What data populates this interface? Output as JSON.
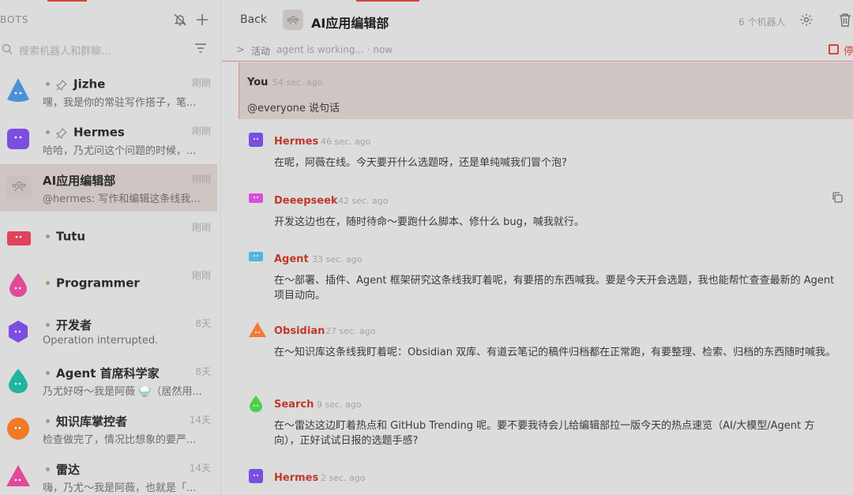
{
  "sidebar": {
    "title": "BOTS",
    "search_placeholder": "搜索机器人和群聊...",
    "items": [
      {
        "name": "Jizhe",
        "time": "刚刚",
        "preview": "嘿，我是你的常驻写作搭子，笔...",
        "pinned": true,
        "color": "#4a90d9",
        "shape": "drop"
      },
      {
        "name": "Hermes",
        "time": "刚刚",
        "preview": "哈哈，乃尤问这个问题的时候，...",
        "pinned": true,
        "color": "#7b4ee0",
        "shape": "square"
      },
      {
        "name": "AI应用编辑部",
        "time": "刚刚",
        "preview": "@hermes: 写作和编辑这条线我...",
        "pinned": false,
        "color": "#c8c2bf",
        "shape": "group"
      },
      {
        "name": "Tutu",
        "time": "刚刚",
        "preview": "",
        "pinned": false,
        "color": "#e0445a",
        "shape": "rect"
      },
      {
        "name": "Programmer",
        "time": "刚刚",
        "preview": "",
        "pinned": false,
        "color": "#e04a98",
        "shape": "drop"
      },
      {
        "name": "开发者",
        "time": "8天",
        "preview": "Operation interrupted.",
        "pinned": false,
        "color": "#7b4ee0",
        "shape": "hex"
      },
      {
        "name": "Agent 首席科学家",
        "time": "8天",
        "preview": "乃尤好呀～我是阿薇 🍚（居然用...",
        "pinned": false,
        "color": "#1fb5a0",
        "shape": "drop"
      },
      {
        "name": "知识库掌控者",
        "time": "14天",
        "preview": "检查做完了，情况比想象的要严...",
        "pinned": false,
        "color": "#f07a28",
        "shape": "circle"
      },
      {
        "name": "雷达",
        "time": "14天",
        "preview": "嗨，乃尤～我是阿薇，也就是「...",
        "pinned": false,
        "color": "#e04a98",
        "shape": "triangle"
      }
    ]
  },
  "header": {
    "back_label": "Back",
    "room_title": "AI应用编辑部",
    "bot_count": "6 个机器人"
  },
  "activity": {
    "label": "活动",
    "status": "agent is working... · now",
    "stop_label": "停"
  },
  "you_message": {
    "name": "You",
    "time": "54 sec. ago",
    "text": "@everyone 说句话"
  },
  "messages": [
    {
      "name": "Hermes",
      "time": "46 sec. ago",
      "text": "在呢，阿薇在线。今天要开什么选题呀，还是单纯喊我们冒个泡?",
      "color": "#7b4ee0"
    },
    {
      "name": "Deeepseek",
      "time": "42 sec. ago",
      "text": "开发这边也在，随时待命～要跑什么脚本、修什么 bug，喊我就行。",
      "color": "#d94fd4"
    },
    {
      "name": "Agent",
      "time": "33 sec. ago",
      "text": "在～部署、插件、Agent 框架研究这条线我盯着呢，有要搭的东西喊我。要是今天开会选题，我也能帮忙查查最新的 Agent 项目动向。",
      "color": "#4fb6e0"
    },
    {
      "name": "Obsidian",
      "time": "27 sec. ago",
      "text": "在～知识库这条线我盯着呢：Obsidian 双库、有道云笔记的稿件归档都在正常跑，有要整理、检索、归档的东西随时喊我。",
      "color": "#f07a38"
    },
    {
      "name": "Search",
      "time": "9 sec. ago",
      "text": "在～雷达这边盯着热点和 GitHub Trending 呢。要不要我待会儿给编辑部拉一版今天的热点速览（AI/大模型/Agent 方向），正好试试日报的选题手感?",
      "color": "#4ccf4c"
    },
    {
      "name": "Hermes",
      "time": "2 sec. ago",
      "text": "",
      "color": "#7b4ee0"
    }
  ]
}
